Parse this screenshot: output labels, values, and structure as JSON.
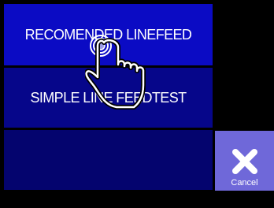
{
  "options": {
    "recommended_linefeed": "RECOMENDED LINEFEED",
    "simple_linefeed_test": "SIMPLE LINE FEEDTEST",
    "empty_slot": ""
  },
  "cancel": {
    "label": "Cancel",
    "icon": "close-icon"
  },
  "overlay": {
    "icon": "tap-hand-icon"
  },
  "colors": {
    "background": "#000000",
    "option_active": "#0b0bc4",
    "option_mid": "#06068a",
    "option_dark": "#04046e",
    "cancel_bg": "#6f68d9",
    "text": "#ffffff"
  }
}
